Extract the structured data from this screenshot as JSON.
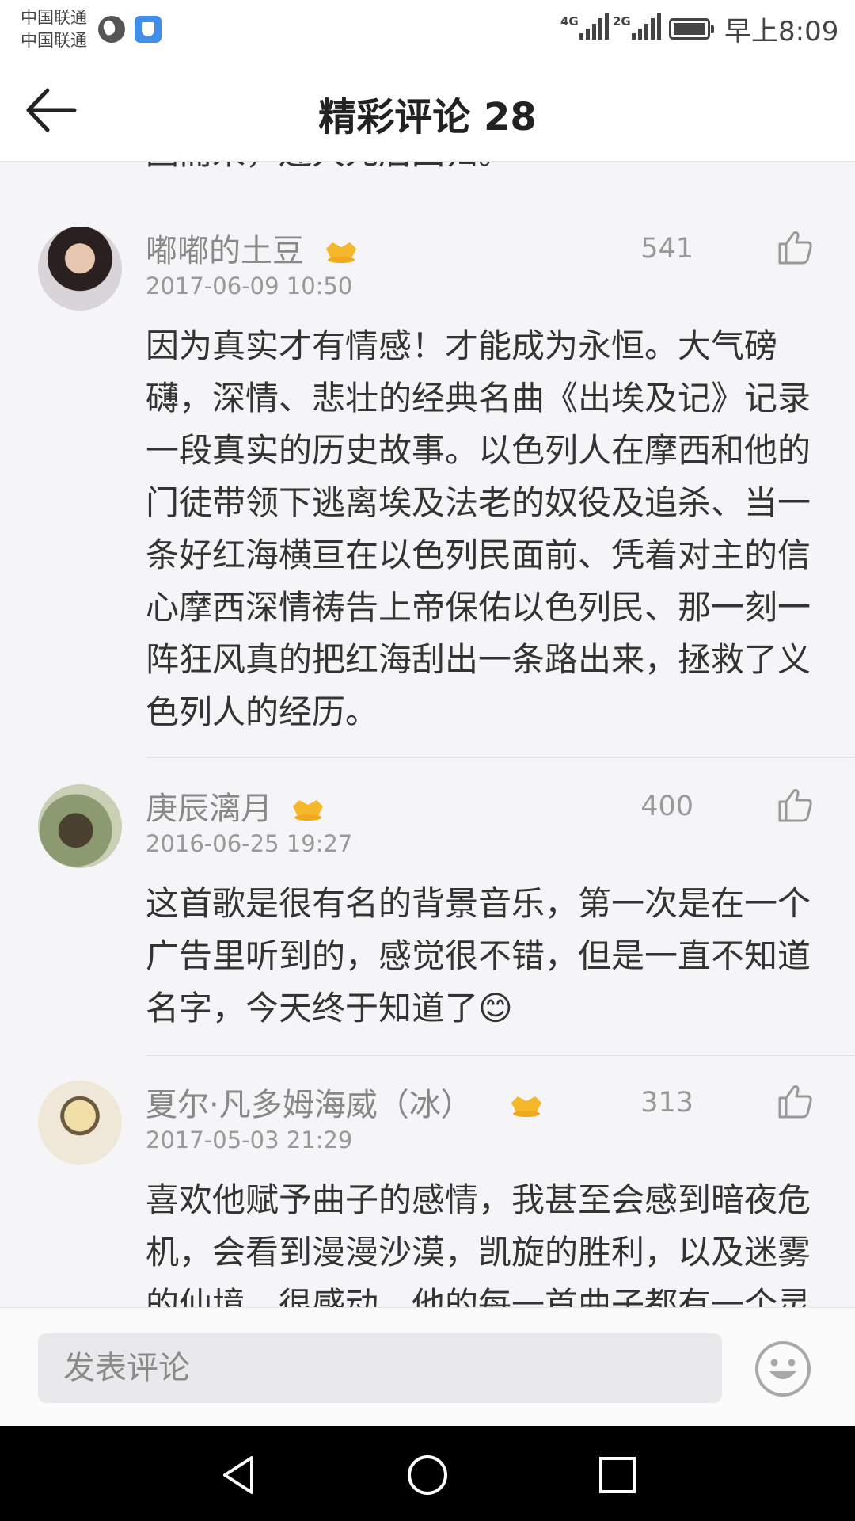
{
  "status_bar": {
    "carrier_1": "中国联通",
    "carrier_2": "中国联通",
    "network_1": "4G",
    "network_2": "2G",
    "time": "早上8:09"
  },
  "header": {
    "title": "精彩评论 28"
  },
  "previous_comment_tail": "因而来，连大死后回归。",
  "comments": [
    {
      "username": "嘟嘟的土豆",
      "timestamp": "2017-06-09 10:50",
      "likes": "541",
      "lines": [
        "因为真实才有情感！才能成为永恒。大气磅",
        "礴，深情、悲壮的经典名曲《出埃及记》记录",
        "一段真实的历史故事。以色列人在摩西和他的",
        "门徒带领下逃离埃及法老的奴役及追杀、当一",
        "条好红海横亘在以色列民面前、凭着对主的信",
        "心摩西深情祷告上帝保佑以色列民、那一刻一",
        "阵狂风真的把红海刮出一条路出来，拯救了义",
        "色列人的经历。"
      ]
    },
    {
      "username": "庚辰漓月",
      "timestamp": "2016-06-25 19:27",
      "likes": "400",
      "lines": [
        "这首歌是很有名的背景音乐，第一次是在一个",
        "广告里听到的，感觉很不错，但是一直不知道",
        "名字，今天终于知道了😊"
      ]
    },
    {
      "username": "夏尔·凡多姆海威（冰）",
      "timestamp": "2017-05-03 21:29",
      "likes": "313",
      "lines": [
        "喜欢他赋予曲子的感情，我甚至会感到暗夜危",
        "机，会看到漫漫沙漠，凯旋的胜利，以及迷雾",
        "的仙境，很感动，他的每一首曲子都有一个灵"
      ]
    }
  ],
  "input_bar": {
    "placeholder": "发表评论"
  },
  "icons": {
    "back": "back-arrow-icon",
    "like": "thumbs-up-icon",
    "vip": "vip-crown-icon",
    "emoji": "smiley-icon",
    "nav_back": "triangle-back-icon",
    "nav_home": "circle-home-icon",
    "nav_recents": "square-recents-icon"
  },
  "colors": {
    "background": "#f5f5f7",
    "text": "#333333",
    "meta": "#999999",
    "vip_gold": "#f5b82a",
    "nav_bar": "#000000"
  }
}
